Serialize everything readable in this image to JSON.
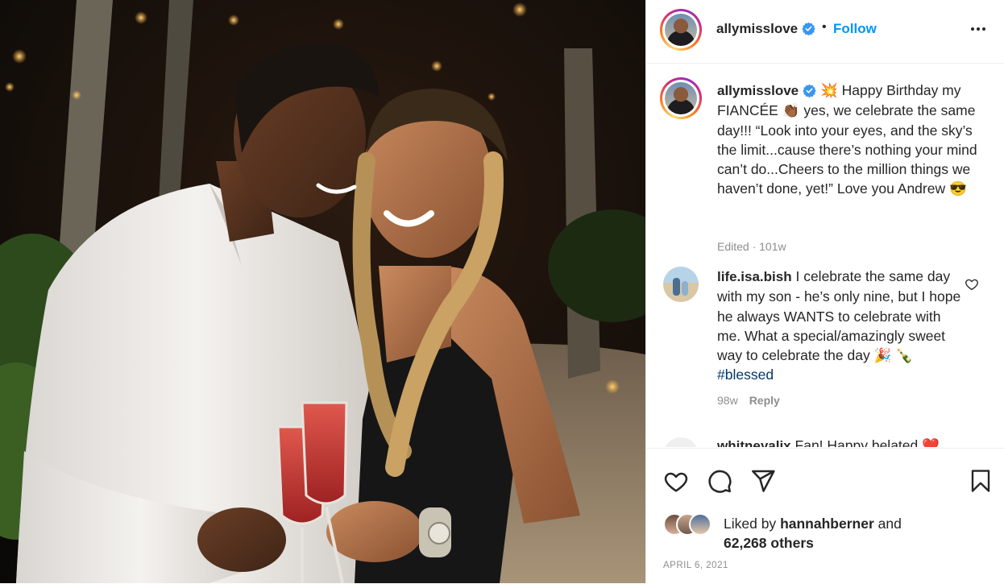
{
  "post": {
    "username": "allymisslove",
    "follow_label": "Follow",
    "separator": "•",
    "verified_badge_icon": "verified-badge-icon",
    "more_icon": "more-options-icon"
  },
  "caption": {
    "username": "allymisslove",
    "emoji_start": "💥",
    "text_1": "Happy Birthday my FIANCÉE",
    "emoji_hand": "👏🏾",
    "text_2": "yes, we celebrate the same day!!! “Look into your eyes, and the sky’s the limit...cause there’s nothing your mind can’t do...Cheers to the million things we haven’t done, yet!” Love you Andrew",
    "emoji_end": "😎",
    "meta": "Edited · 101w"
  },
  "comments": [
    {
      "username": "life.isa.bish",
      "text_1": "I celebrate the same day with my son - he’s only nine, but I hope he always WANTS to celebrate with me. What a special/amazingly sweet way to celebrate the day",
      "emoji_1": "🎉",
      "emoji_2": "🍾",
      "hashtag": "#blessed",
      "age": "98w",
      "reply_label": "Reply"
    },
    {
      "username": "whitneyalix",
      "text": "Fan! Happy belated",
      "emoji": "❤️"
    }
  ],
  "likes": {
    "prefix": "Liked by",
    "user": "hannahberner",
    "conj": "and",
    "others": "62,268 others"
  },
  "date": "APRIL 6, 2021",
  "colors": {
    "accent": "#0095f6",
    "text": "#262626",
    "muted": "#8e8e8e",
    "hashtag": "#00376b",
    "divider": "#efefef"
  }
}
